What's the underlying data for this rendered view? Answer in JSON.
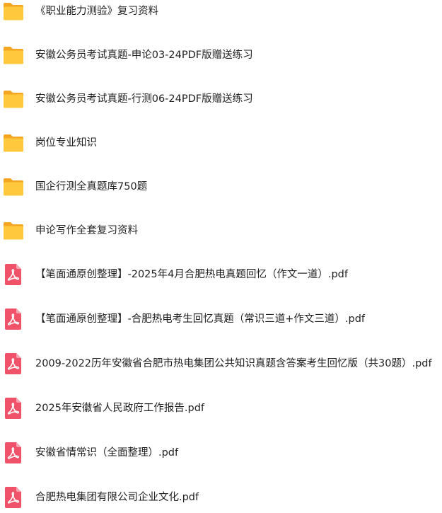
{
  "colors": {
    "folder_front": "#FFC83D",
    "folder_back": "#F4A623",
    "pdf_body": "#F0526A",
    "pdf_fold": "#F8A3B0",
    "text": "#1F1F1F"
  },
  "items": [
    {
      "type": "folder",
      "icon": "folder-icon",
      "name": "《职业能力测验》复习资料"
    },
    {
      "type": "folder",
      "icon": "folder-icon",
      "name": "安徽公务员考试真题-申论03-24PDF版赠送练习"
    },
    {
      "type": "folder",
      "icon": "folder-icon",
      "name": "安徽公务员考试真题-行测06-24PDF版赠送练习"
    },
    {
      "type": "folder",
      "icon": "folder-icon",
      "name": "岗位专业知识"
    },
    {
      "type": "folder",
      "icon": "folder-icon",
      "name": "国企行测全真题库750题"
    },
    {
      "type": "folder",
      "icon": "folder-icon",
      "name": "申论写作全套复习资料"
    },
    {
      "type": "pdf",
      "icon": "pdf-file-icon",
      "name": "【笔面通原创整理】-2025年4月合肥热电真题回忆（作文一道）.pdf"
    },
    {
      "type": "pdf",
      "icon": "pdf-file-icon",
      "name": "【笔面通原创整理】-合肥热电考生回忆真题（常识三道+作文三道）.pdf"
    },
    {
      "type": "pdf",
      "icon": "pdf-file-icon",
      "name": "2009-2022历年安徽省合肥市热电集团公共知识真题含答案考生回忆版（共30题）.pdf"
    },
    {
      "type": "pdf",
      "icon": "pdf-file-icon",
      "name": "2025年安徽省人民政府工作报告.pdf"
    },
    {
      "type": "pdf",
      "icon": "pdf-file-icon",
      "name": "安徽省情常识（全面整理）.pdf"
    },
    {
      "type": "pdf",
      "icon": "pdf-file-icon",
      "name": "合肥热电集团有限公司企业文化.pdf"
    }
  ]
}
